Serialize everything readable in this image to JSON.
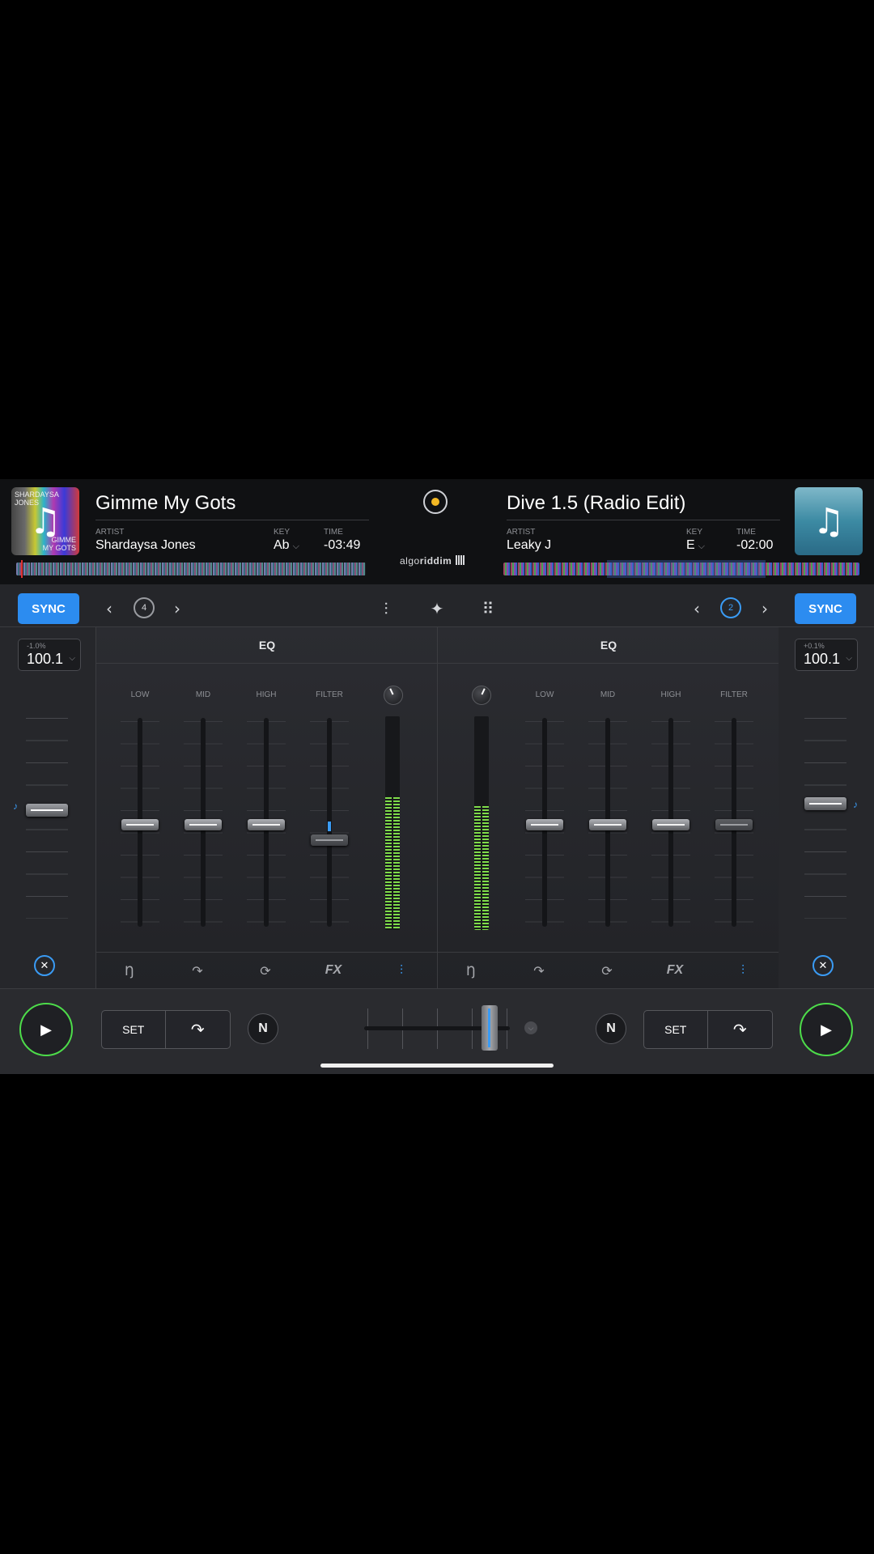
{
  "deck_a": {
    "title": "Gimme My Gots",
    "artist_label": "ARTIST",
    "artist": "Shardaysa Jones",
    "key_label": "KEY",
    "key": "Ab",
    "time_label": "TIME",
    "time": "-03:49",
    "art_text_top": "SHARDAYSA JONES",
    "art_text_bottom": "GIMME MY GOTS",
    "pitch_pct": "-1.0%",
    "pitch": "100.1",
    "loop_size": "4"
  },
  "deck_b": {
    "title": "Dive 1.5 (Radio Edit)",
    "artist_label": "ARTIST",
    "artist": "Leaky J",
    "key_label": "KEY",
    "key": "E",
    "time_label": "TIME",
    "time": "-02:00",
    "pitch_pct": "+0.1%",
    "pitch": "100.1",
    "loop_size": "2"
  },
  "logo": {
    "light": "algo",
    "bold": "riddim"
  },
  "toolbar": {
    "sync_label": "SYNC"
  },
  "mixer": {
    "eq_title": "EQ",
    "channel_labels": [
      "LOW",
      "MID",
      "HIGH",
      "FILTER"
    ]
  },
  "meters": {
    "left_level": 0.62,
    "right_level": 0.58
  },
  "transport": {
    "set_label": "SET",
    "n_label": "N"
  },
  "colors": {
    "accent": "#2c8cf0",
    "play": "#4ddc4a",
    "meter": "#7fdc4a",
    "record": "#f3b824"
  },
  "icons": {
    "play": "play-icon",
    "cue": "cue-arrow-icon",
    "loop": "loop-icon",
    "fx": "fx-icon",
    "eq": "eq-sliders-icon",
    "mixer": "mixer-icon",
    "waveform": "waveform-icon",
    "pads": "pads-grid-icon",
    "close": "close-icon"
  }
}
